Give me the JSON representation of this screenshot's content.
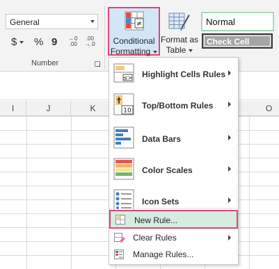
{
  "ribbon": {
    "number_format_value": "General",
    "currency_symbol": "$",
    "percent_symbol": "%",
    "comma_symbol": "9",
    "increase_decimal": {
      "top": "←0",
      "bottom": ".00"
    },
    "decrease_decimal": {
      "top": ".00",
      "bottom": "→.0"
    },
    "number_group_label": "Number",
    "conditional_formatting": {
      "line1": "Conditional",
      "line2": "Formatting"
    },
    "format_as_table": {
      "line1": "Format as",
      "line2": "Table"
    },
    "styles": {
      "normal": "Normal",
      "check_cell": "Check Cell"
    }
  },
  "columns": [
    "I",
    "J",
    "K",
    "O"
  ],
  "menu": {
    "items": [
      {
        "label": "Highlight Cells Rules",
        "icon": "highlight-cells-icon",
        "submenu": true
      },
      {
        "label": "Top/Bottom Rules",
        "icon": "top-bottom-icon",
        "icon_text": "10",
        "submenu": true
      },
      {
        "label": "Data Bars",
        "icon": "data-bars-icon",
        "submenu": true
      },
      {
        "label": "Color Scales",
        "icon": "color-scales-icon",
        "submenu": true
      },
      {
        "label": "Icon Sets",
        "icon": "icon-sets-icon",
        "submenu": true
      },
      {
        "label": "New Rule...",
        "icon": "new-rule-icon",
        "submenu": false,
        "highlighted": true
      },
      {
        "label": "Clear Rules",
        "icon": "clear-rules-icon",
        "submenu": true
      },
      {
        "label": "Manage Rules...",
        "icon": "manage-rules-icon",
        "submenu": false
      }
    ]
  },
  "colors": {
    "highlight_border": "#e0457b",
    "cf_button_bg": "#d2e6f6",
    "new_rule_bg": "#d5ecdf",
    "normal_style_border": "#a9d7bb",
    "check_cell_bg": "#a5a5a5"
  }
}
